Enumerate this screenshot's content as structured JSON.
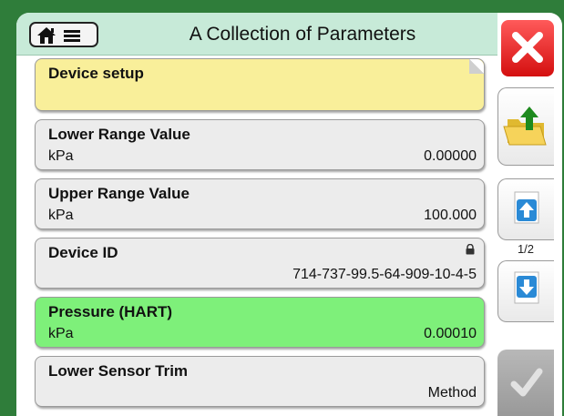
{
  "header": {
    "title": "A Collection of Parameters",
    "home_icon": "home-icon",
    "menu_icon": "menu-icon"
  },
  "rows": [
    {
      "label": "Device setup",
      "unit": "",
      "value": "",
      "style": "yellow"
    },
    {
      "label": "Lower Range Value",
      "unit": "kPa",
      "value": "0.00000",
      "style": "normal"
    },
    {
      "label": "Upper Range Value",
      "unit": "kPa",
      "value": "100.000",
      "style": "normal"
    },
    {
      "label": "Device ID",
      "unit": "",
      "value": "714-737-99.5-64-909-10-4-5",
      "style": "locked"
    },
    {
      "label": "Pressure (HART)",
      "unit": "kPa",
      "value": "0.00010",
      "style": "green"
    },
    {
      "label": "Lower Sensor Trim",
      "unit": "",
      "value": "Method",
      "style": "normal"
    }
  ],
  "sidebar": {
    "page_indicator": "1/2",
    "close_icon": "close-icon",
    "up_folder_icon": "folder-up-icon",
    "page_up_icon": "page-up-icon",
    "page_down_icon": "page-down-icon",
    "accept_icon": "checkmark-icon"
  },
  "colors": {
    "background": "#2f7d3a",
    "header": "#c7ead8",
    "yellow_row": "#f9ef9a",
    "green_row": "#7ef07a",
    "close": "#e21b1b"
  }
}
